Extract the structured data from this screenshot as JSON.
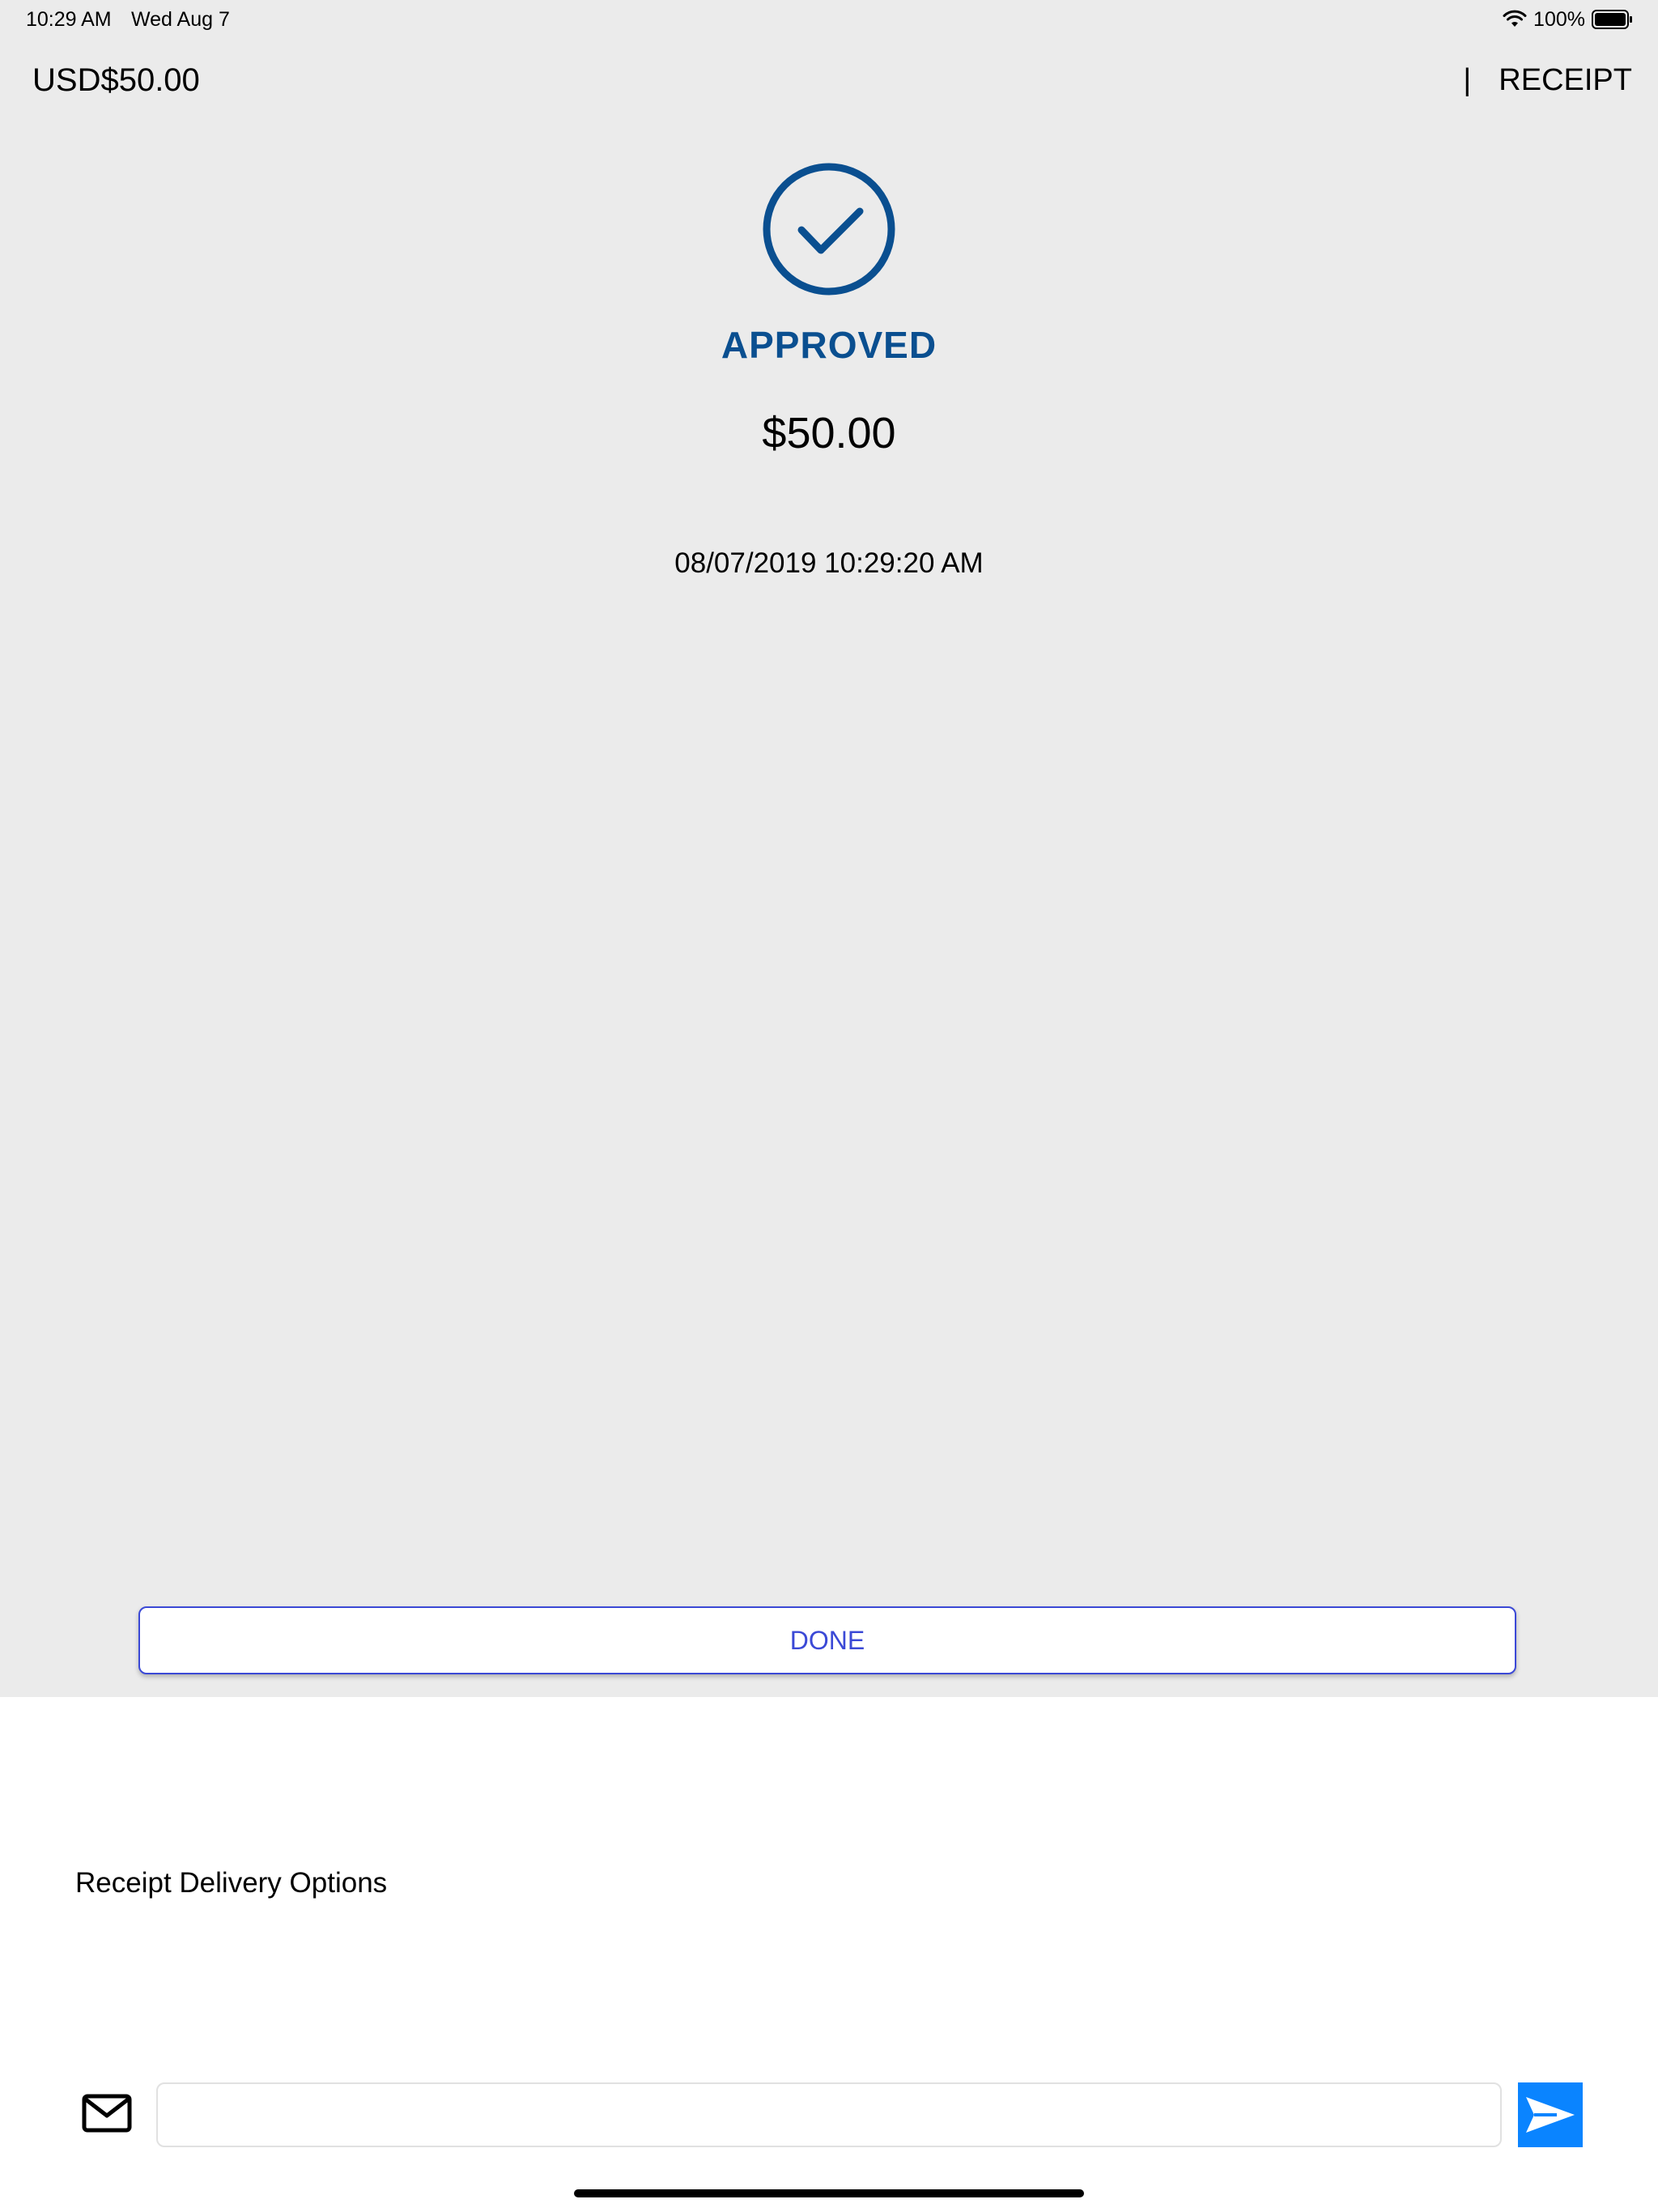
{
  "status_bar": {
    "time": "10:29 AM",
    "date": "Wed Aug 7",
    "battery_percent": "100%",
    "icons": [
      "wifi-icon",
      "battery-icon"
    ]
  },
  "header": {
    "amount": "USD$50.00",
    "separator": "|",
    "receipt_label": "RECEIPT"
  },
  "transaction": {
    "status_icon": "checkmark-circle-icon",
    "status": "APPROVED",
    "amount": "$50.00",
    "timestamp": "08/07/2019 10:29:20 AM"
  },
  "actions": {
    "done_label": "DONE"
  },
  "receipt_delivery": {
    "title": "Receipt Delivery Options",
    "email_icon": "mail-icon",
    "email_value": "",
    "email_placeholder": "",
    "send_icon": "send-icon"
  },
  "colors": {
    "top_background": "#ebebeb",
    "approved_blue": "#0a4f90",
    "done_button_blue": "#3b49d6",
    "send_button_blue": "#0a84ff"
  }
}
